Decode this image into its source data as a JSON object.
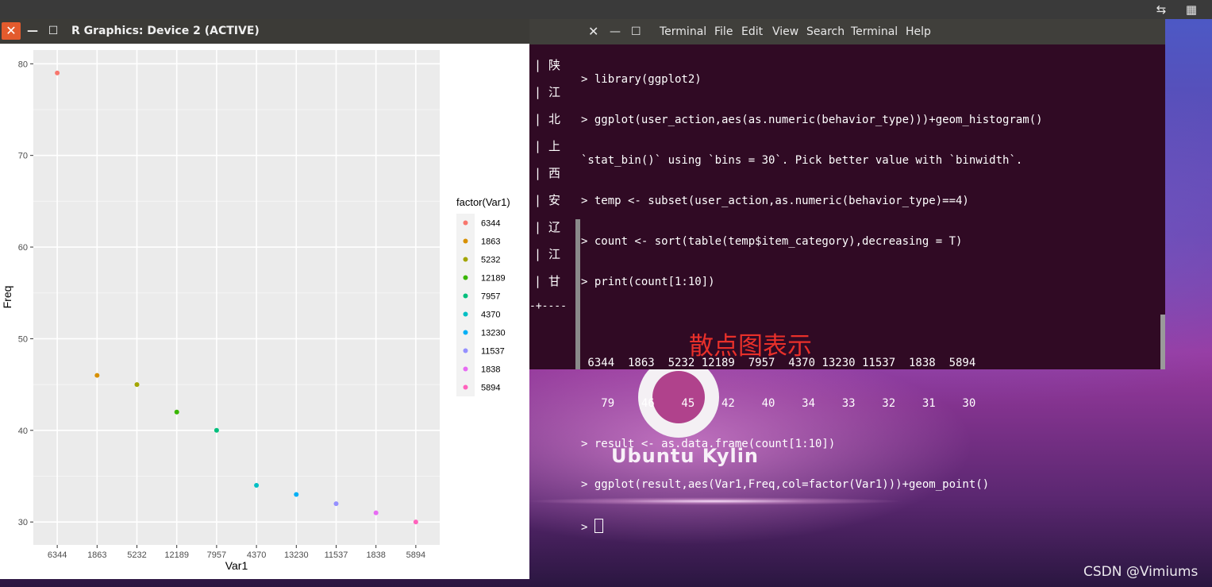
{
  "desktop": {
    "logo_text": "Ubuntu Kylin",
    "watermark": "CSDN @Vimiums",
    "annotation": "散点图表示"
  },
  "top_panel": {
    "icons": [
      "network-icon",
      "calendar-icon"
    ]
  },
  "r_window": {
    "title": "R Graphics: Device 2 (ACTIVE)",
    "close_label": "✕",
    "min_label": "—",
    "max_label": "☐"
  },
  "terminal": {
    "menu": [
      "Terminal",
      "File",
      "Edit",
      "View",
      "Search",
      "Terminal",
      "Help"
    ],
    "left_pane_chars": [
      "| 陕",
      "| 江",
      "| 北",
      "| 上",
      "| 西",
      "| 安",
      "| 辽",
      "| 江",
      "| 甘"
    ],
    "left_pane_rule": "-+----",
    "lines": [
      "> library(ggplot2)",
      "> ggplot(user_action,aes(as.numeric(behavior_type)))+geom_histogram()",
      "`stat_bin()` using `bins = 30`. Pick better value with `binwidth`.",
      "> temp <- subset(user_action,as.numeric(behavior_type)==4)",
      "> count <- sort(table(temp$item_category),decreasing = T)",
      "> print(count[1:10])",
      "",
      " 6344  1863  5232 12189  7957  4370 13230 11537  1838  5894",
      "   79    46    45    42    40    34    33    32    31    30",
      "> result <- as.data.frame(count[1:10])",
      "> ggplot(result,aes(Var1,Freq,col=factor(Var1)))+geom_point()"
    ],
    "prompt": "> "
  },
  "chart_data": {
    "type": "scatter",
    "categories": [
      "6344",
      "1863",
      "5232",
      "12189",
      "7957",
      "4370",
      "13230",
      "11537",
      "1838",
      "5894"
    ],
    "values": [
      79,
      46,
      45,
      42,
      40,
      34,
      33,
      32,
      31,
      30
    ],
    "colors": [
      "#F8766D",
      "#D89000",
      "#A3A500",
      "#39B600",
      "#00BF7D",
      "#00BFC4",
      "#00B0F6",
      "#9590FF",
      "#E76BF3",
      "#FF62BC"
    ],
    "xlabel": "Var1",
    "ylabel": "Freq",
    "yticks": [
      30,
      40,
      50,
      60,
      70,
      80
    ],
    "ylim": [
      27.5,
      81.5
    ],
    "legend_title": "factor(Var1)",
    "legend_position": "right",
    "grid": true
  }
}
